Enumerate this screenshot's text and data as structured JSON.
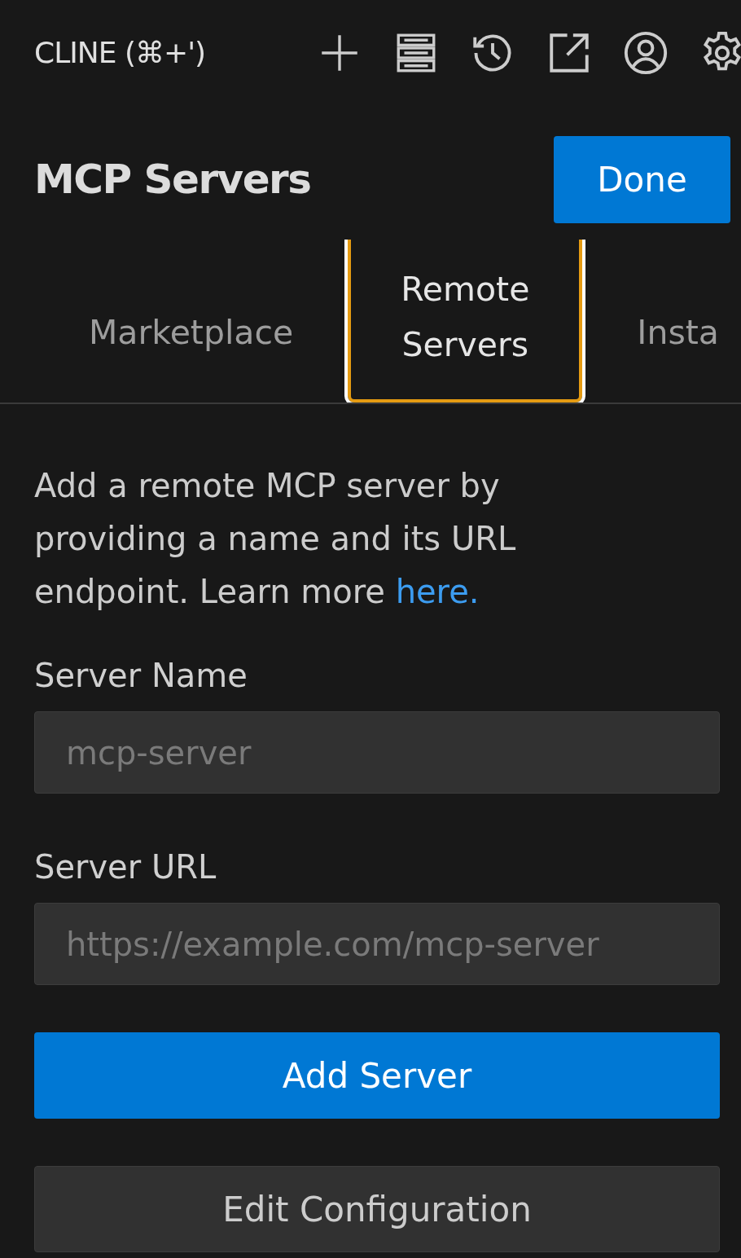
{
  "header": {
    "title": "CLINE (⌘+')"
  },
  "panel": {
    "title": "MCP Servers",
    "done_button": "Done"
  },
  "tabs": [
    {
      "label": "Marketplace",
      "selected": false
    },
    {
      "label": "Remote Servers",
      "selected": true
    },
    {
      "label": "Insta",
      "selected": false
    }
  ],
  "description": {
    "text": "Add a remote MCP server by providing a name and its URL endpoint. Learn more",
    "link": "here."
  },
  "fields": [
    {
      "label": "Server Name",
      "placeholder": "mcp-server"
    },
    {
      "label": "Server URL",
      "placeholder": "https://example.com/mcp-server"
    }
  ],
  "buttons": [
    {
      "label": "Add Server",
      "kind": "primary"
    },
    {
      "label": "Edit Configuration",
      "kind": "secondary"
    }
  ]
}
